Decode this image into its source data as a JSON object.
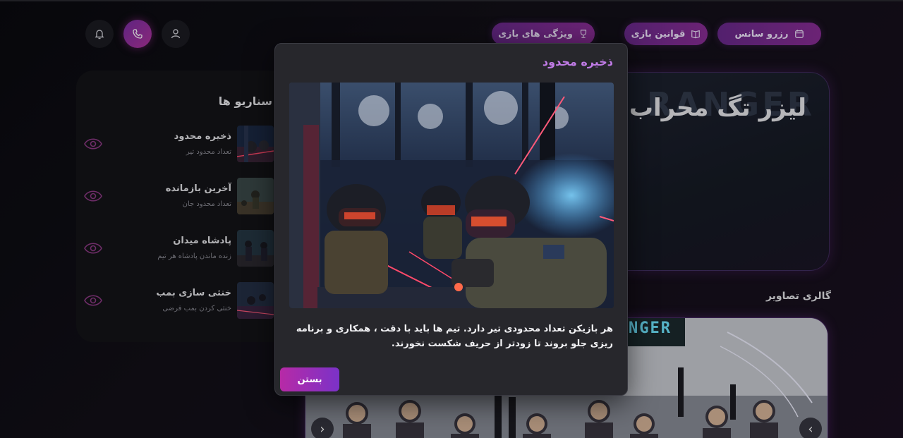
{
  "nav": {
    "reserve": "رزرو سانس",
    "rules": "قوانین بازی",
    "features": "ویژگی های بازی"
  },
  "scenarios": {
    "title": "سناریو ها",
    "items": [
      {
        "name": "ذخیره محدود",
        "desc": "تعداد محدود تیر"
      },
      {
        "name": "آخرین بازمانده",
        "desc": "تعداد محدود جان"
      },
      {
        "name": "پادشاه میدان",
        "desc": "زنده ماندن پادشاه هر تیم"
      },
      {
        "name": "خنثی سازی بمب",
        "desc": "خنثی کردن بمب فرضی"
      }
    ]
  },
  "hero": {
    "title": "لیزر تگ محراب",
    "bg_sign": "RANGER"
  },
  "gallery": {
    "title": "گالری تصاویر",
    "sign": "NGER"
  },
  "modal": {
    "title": "ذخیره محدود",
    "text": "هر بازیکن تعداد محدودی تیر دارد. تیم ها باید با دقت ، همکاری و برنامه ریزی جلو بروند تا زودتر از حریف شکست نخورند.",
    "close_label": "بستن"
  },
  "colors": {
    "accent": "#c07be6",
    "pill": "#7a2c92",
    "modal_bg": "#27272c"
  }
}
